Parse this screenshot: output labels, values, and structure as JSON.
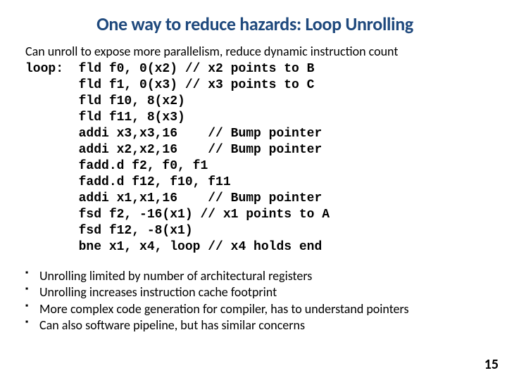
{
  "title": "One way to reduce hazards: Loop Unrolling",
  "intro": "Can unroll to expose more parallelism, reduce dynamic instruction count",
  "code": "loop:  fld f0, 0(x2) // x2 points to B\n       fld f1, 0(x3) // x3 points to C\n       fld f10, 8(x2)\n       fld f11, 8(x3)\n       addi x3,x3,16    // Bump pointer\n       addi x2,x2,16    // Bump pointer\n       fadd.d f2, f0, f1\n       fadd.d f12, f10, f11\n       addi x1,x1,16    // Bump pointer\n       fsd f2, -16(x1) // x1 points to A\n       fsd f12, -8(x1)\n       bne x1, x4, loop // x4 holds end",
  "bullets": [
    "Unrolling limited by number of architectural registers",
    "Unrolling increases instruction cache footprint",
    "More complex code generation for compiler, has to understand pointers",
    "Can also software pipeline, but has similar concerns"
  ],
  "page_number": "15"
}
